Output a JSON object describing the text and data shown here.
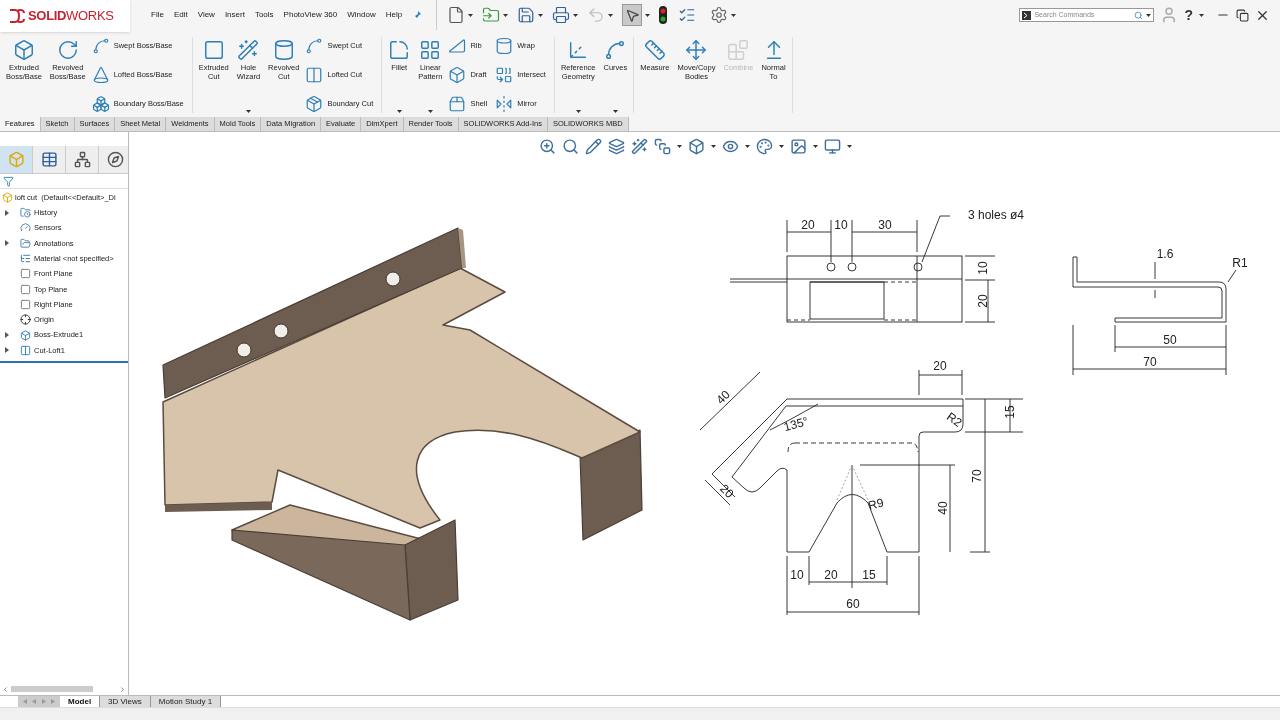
{
  "logo": "**SOLID**WORKS",
  "menu": [
    "File",
    "Edit",
    "View",
    "Insert",
    "Tools",
    "PhotoView 360",
    "Window",
    "Help"
  ],
  "search": {
    "placeholder": "Search Commands"
  },
  "help": "?",
  "ribbon": [
    {
      "columns": [
        {
          "kind": "large",
          "label": "Extruded Boss/Base",
          "menu": false,
          "disabled": false
        },
        {
          "kind": "large",
          "label": "Revolved Boss/Base",
          "menu": false,
          "disabled": false
        },
        {
          "kind": "stack",
          "items": [
            {
              "label": "Swept Boss/Base",
              "disabled": false
            },
            {
              "label": "Lofted Boss/Base",
              "disabled": false
            },
            {
              "label": "Boundary Boss/Base",
              "disabled": false
            }
          ]
        }
      ]
    },
    {
      "columns": [
        {
          "kind": "large",
          "label": "Extruded Cut",
          "menu": false,
          "disabled": false
        },
        {
          "kind": "large",
          "label": "Hole Wizard",
          "menu": true,
          "disabled": false
        },
        {
          "kind": "large",
          "label": "Revolved Cut",
          "menu": false,
          "disabled": false
        },
        {
          "kind": "stack",
          "items": [
            {
              "label": "Swept Cut",
              "disabled": false
            },
            {
              "label": "Lofted Cut",
              "disabled": false
            },
            {
              "label": "Boundary Cut",
              "disabled": false
            }
          ]
        }
      ]
    },
    {
      "columns": [
        {
          "kind": "large",
          "label": "Fillet",
          "menu": true,
          "disabled": false
        },
        {
          "kind": "large",
          "label": "Linear Pattern",
          "menu": true,
          "disabled": false
        },
        {
          "kind": "stack",
          "items": [
            {
              "label": "Rib",
              "disabled": false
            },
            {
              "label": "Draft",
              "disabled": false
            },
            {
              "label": "Shell",
              "disabled": false
            }
          ]
        },
        {
          "kind": "stack",
          "items": [
            {
              "label": "Wrap",
              "disabled": false
            },
            {
              "label": "Intersect",
              "disabled": false
            },
            {
              "label": "Mirror",
              "disabled": false
            }
          ]
        }
      ]
    },
    {
      "columns": [
        {
          "kind": "large",
          "label": "Reference Geometry",
          "menu": true,
          "disabled": false
        },
        {
          "kind": "large",
          "label": "Curves",
          "menu": true,
          "disabled": false
        }
      ]
    },
    {
      "columns": [
        {
          "kind": "large",
          "label": "Measure",
          "menu": false,
          "disabled": false
        },
        {
          "kind": "large",
          "label": "Move/Copy Bodies",
          "menu": false,
          "disabled": false
        },
        {
          "kind": "large",
          "label": "Combine",
          "menu": false,
          "disabled": true
        },
        {
          "kind": "large",
          "label": "Normal To",
          "menu": false,
          "disabled": false
        }
      ]
    }
  ],
  "ribbon_tabs": [
    {
      "label": "Features",
      "selected": true
    },
    {
      "label": "Sketch",
      "selected": false
    },
    {
      "label": "Surfaces",
      "selected": false
    },
    {
      "label": "Sheet Metal",
      "selected": false
    },
    {
      "label": "Weldments",
      "selected": false
    },
    {
      "label": "Mold Tools",
      "selected": false
    },
    {
      "label": "Data Migration",
      "selected": false
    },
    {
      "label": "Evaluate",
      "selected": false
    },
    {
      "label": "DimXpert",
      "selected": false
    },
    {
      "label": "Render Tools",
      "selected": false
    },
    {
      "label": "SOLIDWORKS Add-Ins",
      "selected": false
    },
    {
      "label": "SOLIDWORKS MBD",
      "selected": false
    }
  ],
  "panel_tabs": [
    {
      "selected": true
    },
    {
      "selected": false
    },
    {
      "selected": false
    },
    {
      "selected": false
    }
  ],
  "tree": {
    "root": "loft cut  (Default<<Default>_Di",
    "items": [
      {
        "kind": "folder",
        "label": "History",
        "expander": true
      },
      {
        "kind": "sensor",
        "label": "Sensors",
        "expander": false
      },
      {
        "kind": "annotation",
        "label": "Annotations",
        "expander": true
      },
      {
        "kind": "material",
        "label": "Material <not specified>",
        "expander": false
      },
      {
        "kind": "plane",
        "label": "Front Plane",
        "expander": false
      },
      {
        "kind": "plane",
        "label": "Top Plane",
        "expander": false
      },
      {
        "kind": "plane",
        "label": "Right Plane",
        "expander": false
      },
      {
        "kind": "origin",
        "label": "Origin",
        "expander": false
      },
      {
        "kind": "extrude",
        "label": "Boss-Extrude1",
        "expander": true
      },
      {
        "kind": "cut",
        "label": "Cut-Loft1",
        "expander": true
      }
    ]
  },
  "drawing": {
    "top_view": [
      "20",
      "10",
      "30",
      "3 holes ø4",
      "10",
      "20"
    ],
    "side_view": [
      "1.6",
      "R1",
      "50",
      "70"
    ],
    "front_view": [
      "20",
      "40",
      "135°",
      "R2",
      "15",
      "70",
      "20",
      "R9",
      "40",
      "10",
      "20",
      "15",
      "60"
    ]
  },
  "model_tabs": [
    {
      "label": "Model",
      "selected": true
    },
    {
      "label": "3D Views",
      "selected": false
    },
    {
      "label": "Motion Study 1",
      "selected": false
    }
  ]
}
